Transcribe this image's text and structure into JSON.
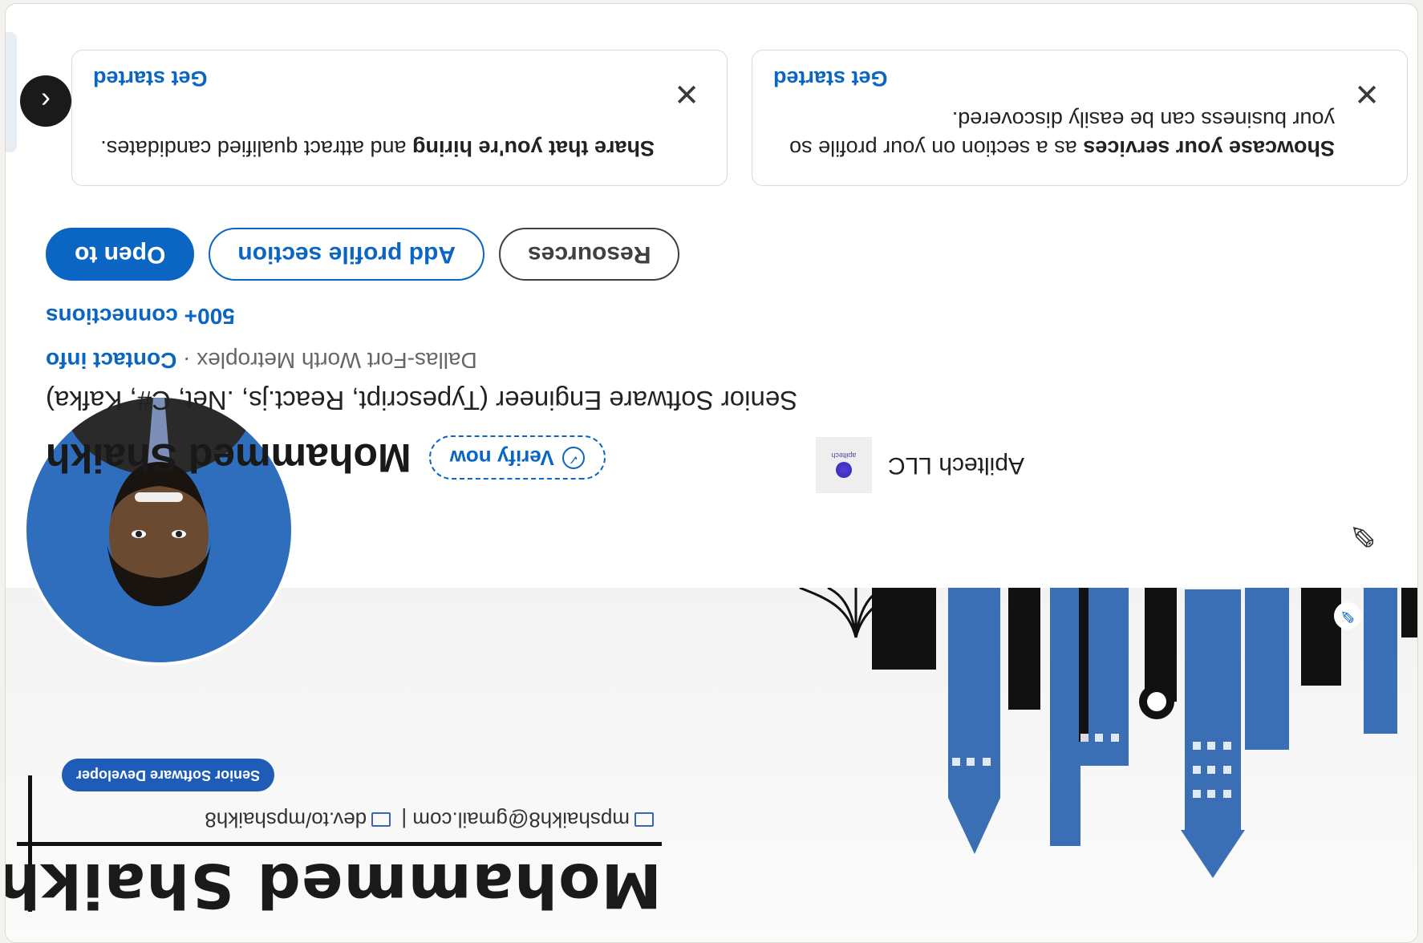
{
  "banner": {
    "name": "Mohammed Shaikh",
    "email": "mpshaikh8@gmail.com",
    "separator": "|",
    "website": "dev.to/mpshaikh8",
    "tag": "Senior Software Developer"
  },
  "profile": {
    "name": "Mohammed Shaikh",
    "verify_label": "Verify now",
    "headline": "Senior Software Engineer (Typescript, React.js, .Net, C#, Kafka)",
    "location": "Dallas-Fort Worth Metroplex",
    "location_separator": "·",
    "contact_info": "Contact info",
    "connections": "500+ connections"
  },
  "company": {
    "name": "Apiltech LLC",
    "logo_text": "apiltech"
  },
  "actions": {
    "open_to": "Open to",
    "add_section": "Add profile section",
    "resources": "Resources"
  },
  "promos": [
    {
      "bold": "Share that you're hiring",
      "text": " and attract qualified candidates.",
      "cta": "Get started"
    },
    {
      "bold": "Showcase your services",
      "text": " as a section on your profile so your business can be easily discovered.",
      "cta": "Get started"
    }
  ],
  "icons": {
    "carousel_prev": "chevron-left-icon",
    "close": "close-icon",
    "edit": "pencil-icon",
    "verify": "shield-check-icon"
  },
  "colors": {
    "accent": "#0a66c2",
    "banner_blue": "#2f6ebd"
  }
}
